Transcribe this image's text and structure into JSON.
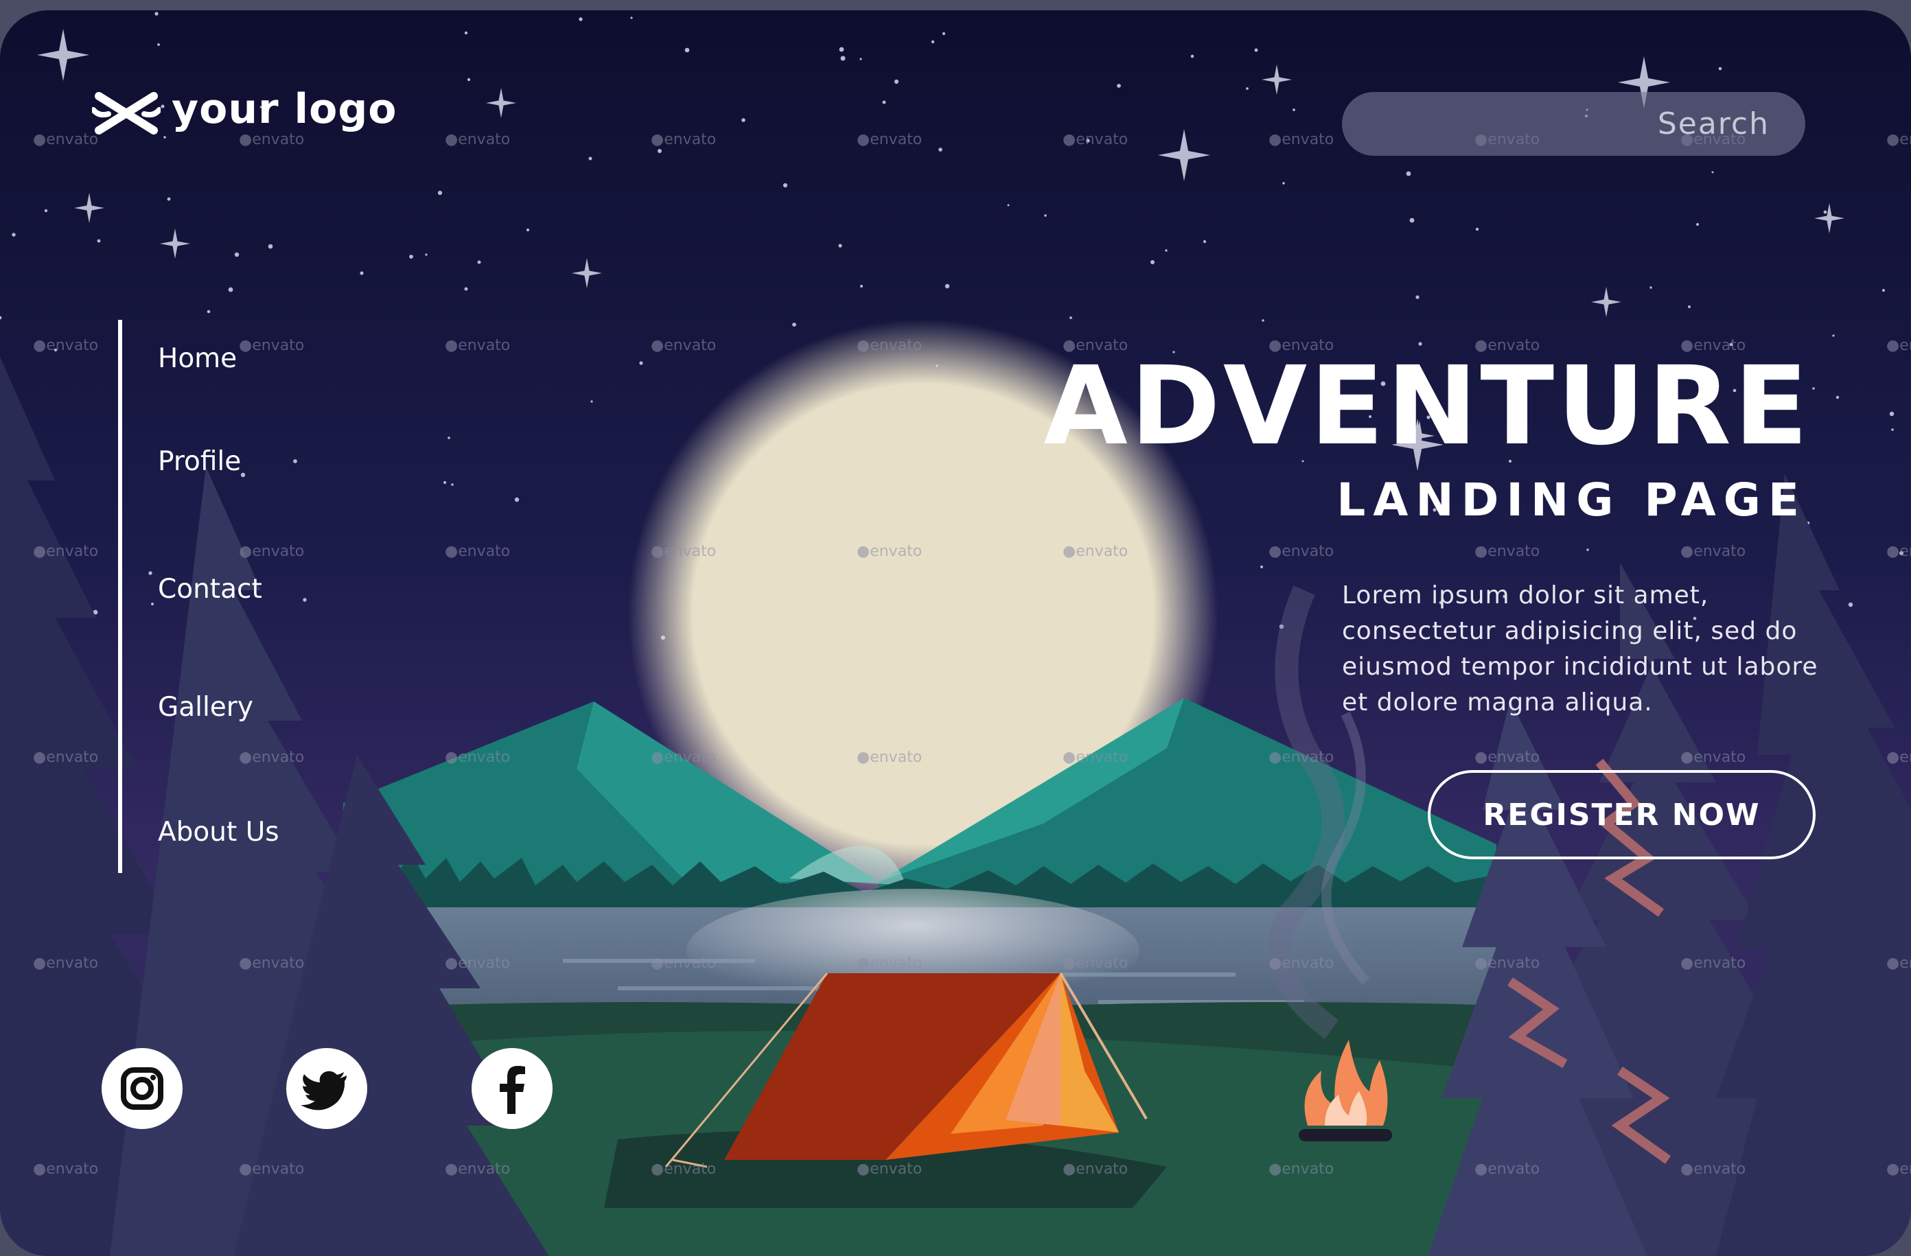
{
  "brand": {
    "logo_text": "your logo",
    "logo_icon": "crossed-tools-icon"
  },
  "search": {
    "placeholder": "Search"
  },
  "nav": {
    "items": [
      {
        "label": "Home"
      },
      {
        "label": "Profile"
      },
      {
        "label": "Contact"
      },
      {
        "label": "Gallery"
      },
      {
        "label": "About Us"
      }
    ]
  },
  "hero": {
    "title": "ADVENTURE",
    "subtitle": "LANDING PAGE",
    "text": "Lorem ipsum dolor sit amet, consectetur adipisicing elit, sed do eiusmod tempor incididunt ut labore et dolore magna aliqua.",
    "cta_label": "REGISTER NOW"
  },
  "social": [
    {
      "icon": "instagram-icon"
    },
    {
      "icon": "twitter-icon"
    },
    {
      "icon": "facebook-icon"
    }
  ],
  "watermark": "envato",
  "colors": {
    "sky_top": "#0f1030",
    "sky_bottom": "#3b2f66",
    "moon": "#e7dfc7",
    "mountain": "#1f8a82",
    "lake": "#5f7590",
    "tent": "#c7390f",
    "fire": "#f38a57"
  }
}
